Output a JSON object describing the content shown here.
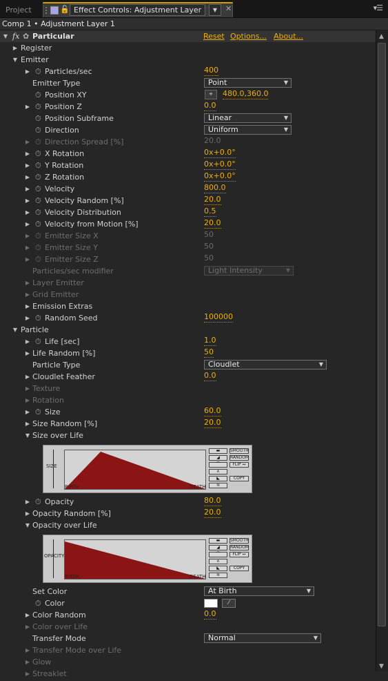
{
  "tabs": {
    "project_label": "Project",
    "effect_controls_label": "Effect Controls: Adjustment Layer 1"
  },
  "comp_line": "Comp 1 • Adjustment Layer 1",
  "effect": {
    "name": "Particular",
    "reset": "Reset",
    "options": "Options...",
    "about": "About..."
  },
  "rows": {
    "register": "Register",
    "emitter": "Emitter",
    "particles_sec": {
      "label": "Particles/sec",
      "value": "400"
    },
    "emitter_type": {
      "label": "Emitter Type",
      "value": "Point"
    },
    "position_xy": {
      "label": "Position XY",
      "value": "480.0,360.0"
    },
    "position_z": {
      "label": "Position Z",
      "value": "0.0"
    },
    "position_subframe": {
      "label": "Position Subframe",
      "value": "Linear"
    },
    "direction": {
      "label": "Direction",
      "value": "Uniform"
    },
    "direction_spread": {
      "label": "Direction Spread [%]",
      "value": "20.0"
    },
    "x_rotation": {
      "label": "X Rotation",
      "value": "0x+0.0°"
    },
    "y_rotation": {
      "label": "Y Rotation",
      "value": "0x+0.0°"
    },
    "z_rotation": {
      "label": "Z Rotation",
      "value": "0x+0.0°"
    },
    "velocity": {
      "label": "Velocity",
      "value": "800.0"
    },
    "velocity_random": {
      "label": "Velocity Random [%]",
      "value": "20.0"
    },
    "velocity_distribution": {
      "label": "Velocity Distribution",
      "value": "0.5"
    },
    "velocity_from_motion": {
      "label": "Velocity from Motion [%]",
      "value": "20.0"
    },
    "emitter_size_x": {
      "label": "Emitter Size X",
      "value": "50"
    },
    "emitter_size_y": {
      "label": "Emitter Size Y",
      "value": "50"
    },
    "emitter_size_z": {
      "label": "Emitter Size Z",
      "value": "50"
    },
    "particles_sec_modifier": {
      "label": "Particles/sec modifier",
      "value": "Light Intensity"
    },
    "layer_emitter": "Layer Emitter",
    "grid_emitter": "Grid Emitter",
    "emission_extras": "Emission Extras",
    "random_seed": {
      "label": "Random Seed",
      "value": "100000"
    },
    "particle": "Particle",
    "life": {
      "label": "Life [sec]",
      "value": "1.0"
    },
    "life_random": {
      "label": "Life Random [%]",
      "value": "50"
    },
    "particle_type": {
      "label": "Particle Type",
      "value": "Cloudlet"
    },
    "cloudlet_feather": {
      "label": "Cloudlet Feather",
      "value": "0.0"
    },
    "texture": "Texture",
    "rotation": "Rotation",
    "size": {
      "label": "Size",
      "value": "60.0"
    },
    "size_random": {
      "label": "Size Random [%]",
      "value": "20.0"
    },
    "size_over_life": "Size over Life",
    "opacity": {
      "label": "Opacity",
      "value": "80.0"
    },
    "opacity_random": {
      "label": "Opacity Random [%]",
      "value": "20.0"
    },
    "opacity_over_life": "Opacity over Life",
    "set_color": {
      "label": "Set Color",
      "value": "At Birth"
    },
    "color": {
      "label": "Color",
      "value": "#ffffff"
    },
    "color_random": {
      "label": "Color Random",
      "value": "0.0"
    },
    "color_over_life": "Color over Life",
    "transfer_mode": {
      "label": "Transfer Mode",
      "value": "Normal"
    },
    "transfer_mode_over_life": "Transfer Mode over Life",
    "glow": "Glow",
    "streaklet": "Streaklet"
  },
  "graphs": {
    "size_axis": "SIZE",
    "opacity_axis": "OPACITY",
    "birth": "BIRTH",
    "death": "DEATH",
    "btn_smooth": "SMOOTH",
    "btn_random": "RANDOM",
    "btn_flip": "FLIP ↔",
    "btn_copy": "COPY",
    "curve_color": "#8b1414"
  },
  "colors": {
    "accent": "#f0b000",
    "panel": "#262626"
  }
}
